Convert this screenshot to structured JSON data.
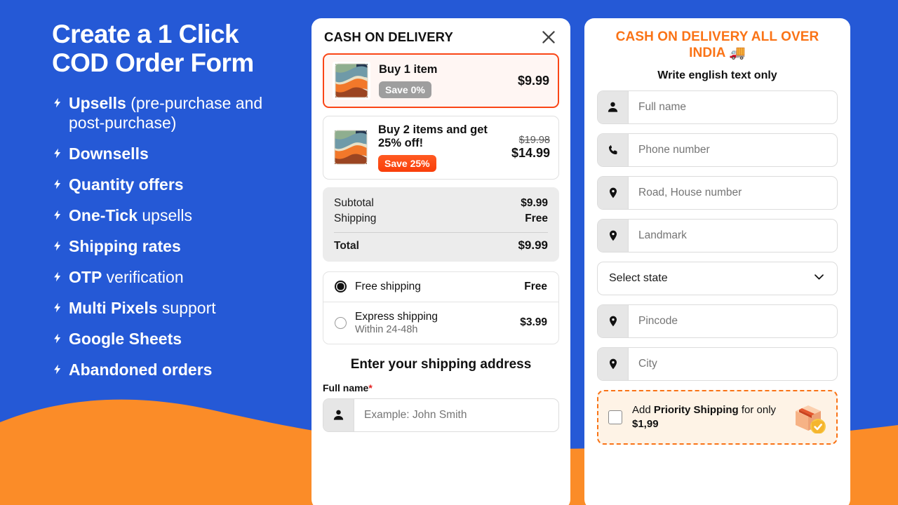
{
  "theme": {
    "blue": "#2559D6",
    "orange": "#FB8C28",
    "accent_orange": "#FA4616",
    "title_orange": "#FA7316"
  },
  "promo": {
    "title": "Create a 1 Click\nCOD Order Form",
    "items": [
      {
        "bold": "Upsells",
        "rest": " (pre-purchase and post-purchase)"
      },
      {
        "bold": "Downsells",
        "rest": ""
      },
      {
        "bold": "Quantity offers",
        "rest": ""
      },
      {
        "bold": "One-Tick",
        "rest": " upsells"
      },
      {
        "bold": "Shipping rates",
        "rest": ""
      },
      {
        "bold": "OTP",
        "rest": " verification"
      },
      {
        "bold": "Multi Pixels",
        "rest": " support"
      },
      {
        "bold": "Google Sheets",
        "rest": ""
      },
      {
        "bold": "Abandoned orders",
        "rest": ""
      }
    ]
  },
  "cod_card": {
    "title": "CASH ON DELIVERY",
    "close_icon": "close-icon",
    "offers": [
      {
        "name": "Buy 1 item",
        "badge": "Save 0%",
        "badge_style": "grey",
        "price_old": "",
        "price_now": "$9.99",
        "selected": true
      },
      {
        "name": "Buy 2 items and get 25% off!",
        "badge": "Save 25%",
        "badge_style": "hot",
        "price_old": "$19.98",
        "price_now": "$14.99",
        "selected": false
      }
    ],
    "summary": {
      "subtotal_label": "Subtotal",
      "subtotal_value": "$9.99",
      "shipping_label": "Shipping",
      "shipping_value": "Free",
      "total_label": "Total",
      "total_value": "$9.99"
    },
    "shipping_options": [
      {
        "name": "Free shipping",
        "sub": "",
        "price": "Free",
        "selected": true
      },
      {
        "name": "Express shipping",
        "sub": "Within 24-48h",
        "price": "$3.99",
        "selected": false
      }
    ],
    "address_heading": "Enter your shipping address",
    "fullname_label": "Full name",
    "required_mark": "*",
    "fullname_placeholder": "Example: John Smith"
  },
  "india_card": {
    "title": "CASH ON DELIVERY ALL OVER INDIA 🚚",
    "subtitle": "Write english text only",
    "fields": [
      {
        "icon": "person-icon",
        "placeholder": "Full name"
      },
      {
        "icon": "phone-icon",
        "placeholder": "Phone number"
      },
      {
        "icon": "location-pin-icon",
        "placeholder": "Road, House number"
      },
      {
        "icon": "location-pin-icon",
        "placeholder": "Landmark"
      }
    ],
    "state_select": {
      "label": "Select state",
      "icon": "chevron-down-icon"
    },
    "fields_after": [
      {
        "icon": "location-pin-icon",
        "placeholder": "Pincode"
      },
      {
        "icon": "location-pin-icon",
        "placeholder": "City"
      }
    ],
    "priority": {
      "text_before": "Add ",
      "text_bold": "Priority Shipping",
      "text_middle": " for only ",
      "price_bold": "$1,99",
      "icon": "package-shield-icon"
    }
  }
}
